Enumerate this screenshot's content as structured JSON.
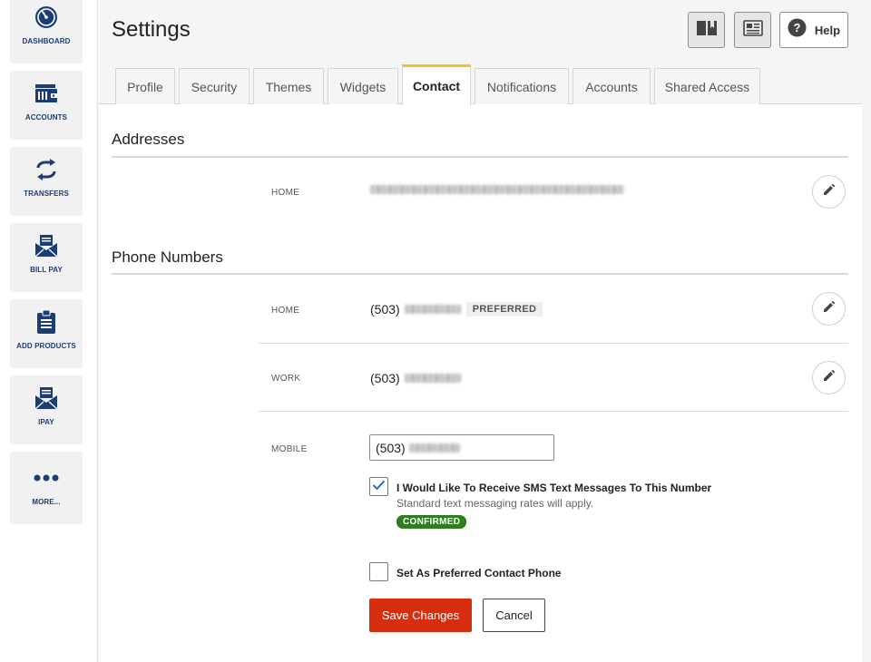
{
  "sidebar": {
    "items": [
      {
        "label": "DASHBOARD",
        "icon": "dashboard-gauge-icon"
      },
      {
        "label": "ACCOUNTS",
        "icon": "wallet-icon"
      },
      {
        "label": "TRANSFERS",
        "icon": "transfer-arrows-icon"
      },
      {
        "label": "BILL PAY",
        "icon": "envelope-icon"
      },
      {
        "label": "ADD PRODUCTS",
        "icon": "clipboard-icon"
      },
      {
        "label": "IPAY",
        "icon": "envelope-icon"
      },
      {
        "label": "MORE...",
        "icon": "more-dots-icon"
      }
    ]
  },
  "header": {
    "title": "Settings",
    "help_label": "Help"
  },
  "tabs": [
    {
      "label": "Profile"
    },
    {
      "label": "Security"
    },
    {
      "label": "Themes"
    },
    {
      "label": "Widgets"
    },
    {
      "label": "Contact",
      "active": true
    },
    {
      "label": "Notifications"
    },
    {
      "label": "Accounts"
    },
    {
      "label": "Shared Access"
    }
  ],
  "addresses": {
    "title": "Addresses",
    "rows": [
      {
        "label": "HOME"
      }
    ]
  },
  "phones": {
    "title": "Phone Numbers",
    "home": {
      "label": "HOME",
      "area": "(503)",
      "badge": "PREFERRED"
    },
    "work": {
      "label": "WORK",
      "area": "(503)"
    },
    "mobile": {
      "label": "MOBILE",
      "area": "(503)"
    }
  },
  "sms": {
    "label": "I Would Like To Receive SMS Text Messages To This Number",
    "sub": "Standard text messaging rates will apply.",
    "badge": "CONFIRMED",
    "checked": true
  },
  "preferred": {
    "label": "Set As Preferred Contact Phone",
    "checked": false
  },
  "actions": {
    "save": "Save Changes",
    "cancel": "Cancel"
  },
  "colors": {
    "brand_navy": "#1c3d72",
    "tab_accent": "#f3c51c",
    "save_red": "#d62e0e",
    "confirmed_green": "#2e7d1f",
    "checkmark_blue": "#1c5fa8"
  }
}
